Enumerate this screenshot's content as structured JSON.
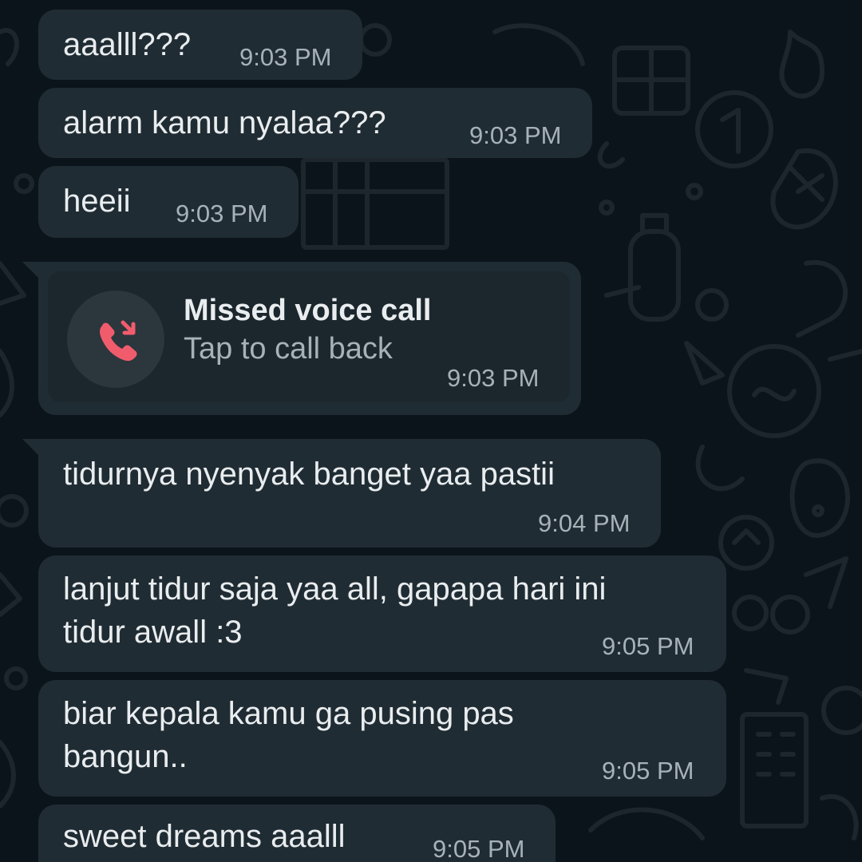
{
  "conversation": {
    "messages": [
      {
        "text": "aaalll???",
        "time": "9:03 PM"
      },
      {
        "text": "alarm kamu nyalaa???",
        "time": "9:03 PM"
      },
      {
        "text": "heeii",
        "time": "9:03 PM"
      },
      {
        "type": "missed-call",
        "title": "Missed voice call",
        "subtitle": "Tap to call back",
        "time": "9:03 PM",
        "icon": "missed-call-icon"
      },
      {
        "text": "tidurnya nyenyak banget yaa pastii",
        "time": "9:04 PM"
      },
      {
        "lines": [
          "lanjut tidur saja yaa all, gapapa hari ini",
          "tidur awall :3"
        ],
        "time": "9:05 PM"
      },
      {
        "lines": [
          "biar kepala kamu ga pusing pas",
          "bangun.."
        ],
        "time": "9:05 PM"
      },
      {
        "text": "sweet dreams aaalll",
        "time": "9:05 PM"
      }
    ]
  },
  "colors": {
    "background": "#0b141a",
    "bubble": "#202c33",
    "call_card": "#1b262d",
    "text": "#e9edef",
    "timestamp": "#a7b2b8",
    "missed_call": "#f15c6d",
    "doodle": "#1c262c"
  }
}
